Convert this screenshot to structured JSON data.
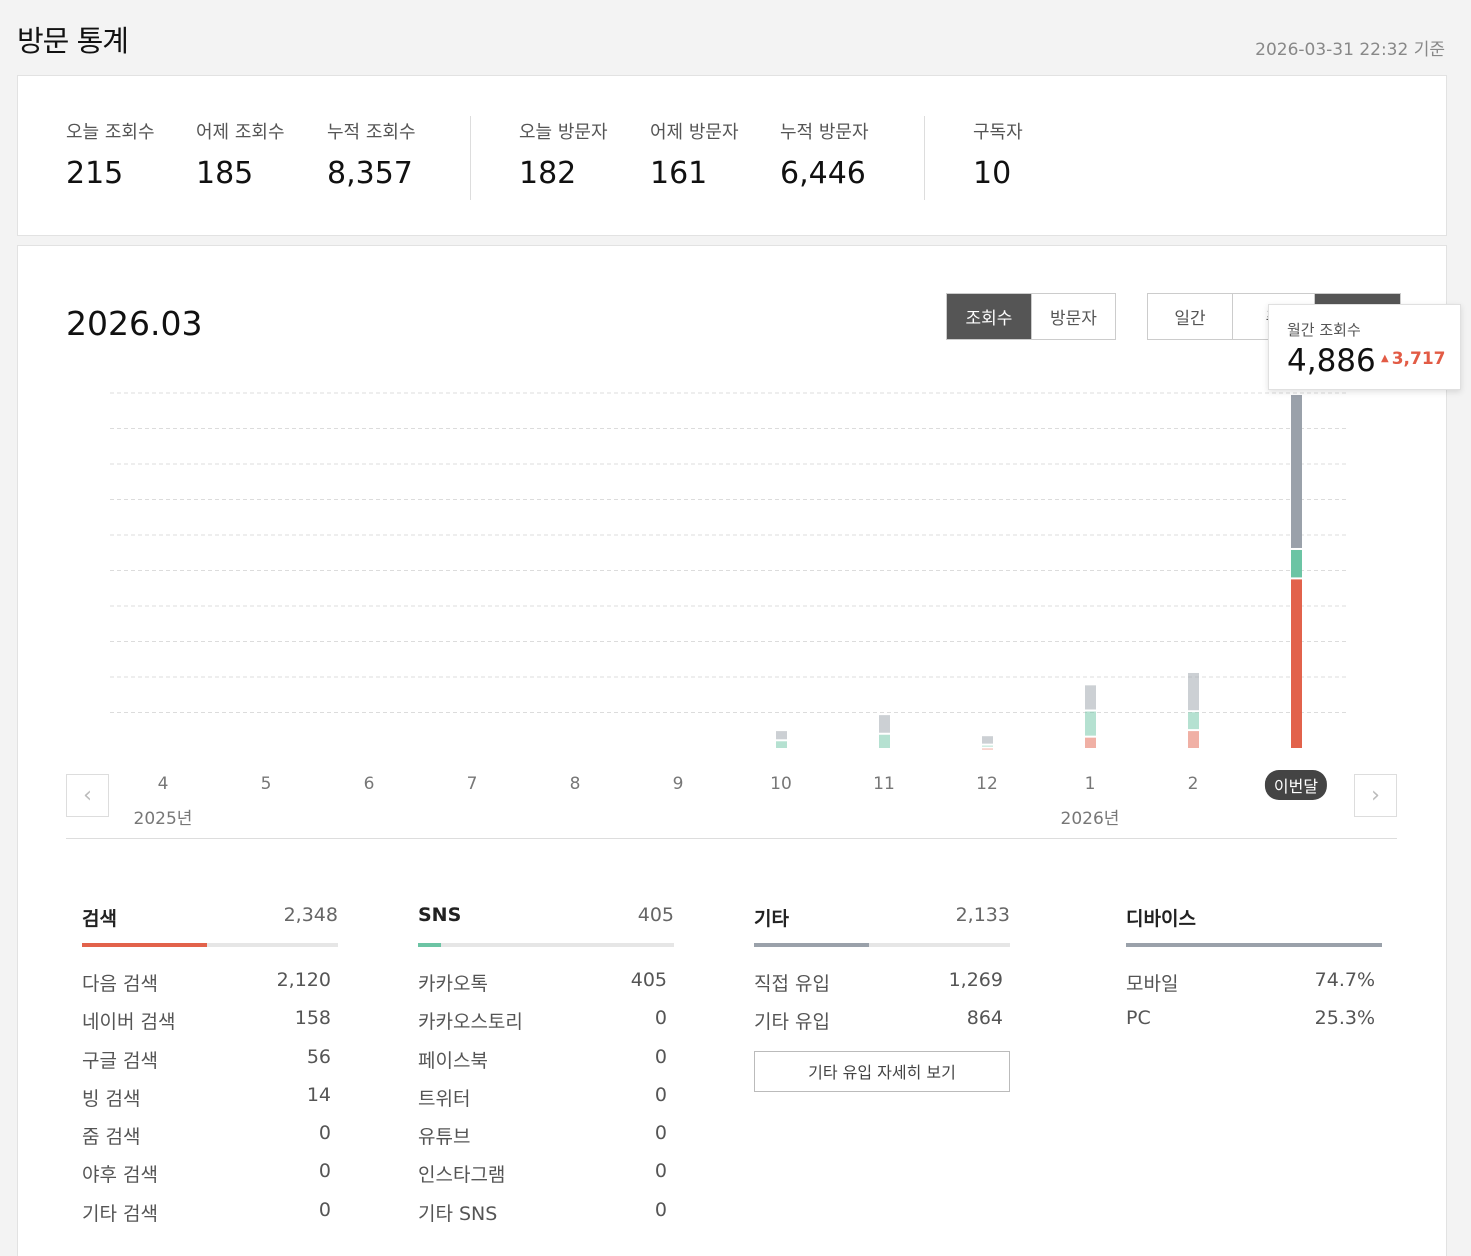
{
  "header": {
    "title": "방문 통계",
    "timestamp": "2026-03-31 22:32 기준"
  },
  "summary": {
    "stats": [
      {
        "label": "오늘 조회수",
        "value": "215"
      },
      {
        "label": "어제 조회수",
        "value": "185"
      },
      {
        "label": "누적 조회수",
        "value": "8,357"
      },
      {
        "label": "오늘 방문자",
        "value": "182"
      },
      {
        "label": "어제 방문자",
        "value": "161"
      },
      {
        "label": "누적 방문자",
        "value": "6,446"
      },
      {
        "label": "구독자",
        "value": "10"
      }
    ]
  },
  "chart_section": {
    "period": "2026.03",
    "metric_tabs": [
      {
        "label": "조회수",
        "active": true
      },
      {
        "label": "방문자",
        "active": false
      }
    ],
    "range_tabs": [
      {
        "label": "일간",
        "active": false
      },
      {
        "label": "주",
        "active": false
      },
      {
        "label": "",
        "active": true
      }
    ],
    "tooltip": {
      "label": "월간 조회수",
      "value": "4,886",
      "delta": "3,717"
    },
    "current_label": "이번달",
    "years": [
      "2025년",
      "2026년"
    ]
  },
  "chart_data": {
    "type": "bar",
    "stacked": true,
    "categories": [
      "4",
      "5",
      "6",
      "7",
      "8",
      "9",
      "10",
      "11",
      "12",
      "1",
      "2",
      "이번달"
    ],
    "series": [
      {
        "name": "검색",
        "color": "#e2624b",
        "values": [
          0,
          0,
          0,
          0,
          0,
          0,
          0,
          0,
          20,
          170,
          260,
          2348
        ]
      },
      {
        "name": "SNS",
        "color": "#6cc4a4",
        "values": [
          0,
          0,
          0,
          0,
          0,
          0,
          120,
          210,
          40,
          360,
          260,
          405
        ]
      },
      {
        "name": "기타",
        "color": "#9aa1aa",
        "values": [
          0,
          0,
          0,
          0,
          0,
          0,
          140,
          270,
          130,
          360,
          540,
          2133
        ]
      }
    ],
    "ylim": [
      0,
      4886
    ],
    "grid": true,
    "highlight_index": 11
  },
  "breakdown": {
    "search": {
      "title": "검색",
      "total": "2,348",
      "color": "#e2624b",
      "fill": 0.49,
      "rows": [
        {
          "label": "다음 검색",
          "value": "2,120"
        },
        {
          "label": "네이버 검색",
          "value": "158"
        },
        {
          "label": "구글 검색",
          "value": "56"
        },
        {
          "label": "빙 검색",
          "value": "14"
        },
        {
          "label": "줌 검색",
          "value": "0"
        },
        {
          "label": "야후 검색",
          "value": "0"
        },
        {
          "label": "기타 검색",
          "value": "0"
        }
      ]
    },
    "sns": {
      "title": "SNS",
      "total": "405",
      "color": "#6cc4a4",
      "fill": 0.09,
      "rows": [
        {
          "label": "카카오톡",
          "value": "405"
        },
        {
          "label": "카카오스토리",
          "value": "0"
        },
        {
          "label": "페이스북",
          "value": "0"
        },
        {
          "label": "트위터",
          "value": "0"
        },
        {
          "label": "유튜브",
          "value": "0"
        },
        {
          "label": "인스타그램",
          "value": "0"
        },
        {
          "label": "기타 SNS",
          "value": "0"
        }
      ]
    },
    "other": {
      "title": "기타",
      "total": "2,133",
      "color": "#9aa1aa",
      "fill": 0.45,
      "rows": [
        {
          "label": "직접 유입",
          "value": "1,269"
        },
        {
          "label": "기타 유입",
          "value": "864"
        }
      ],
      "detail_button": "기타 유입 자세히 보기"
    },
    "device": {
      "title": "디바이스",
      "color": "#9aa1aa",
      "fill": 1.0,
      "rows": [
        {
          "label": "모바일",
          "value": "74.7%"
        },
        {
          "label": "PC",
          "value": "25.3%"
        }
      ]
    }
  }
}
